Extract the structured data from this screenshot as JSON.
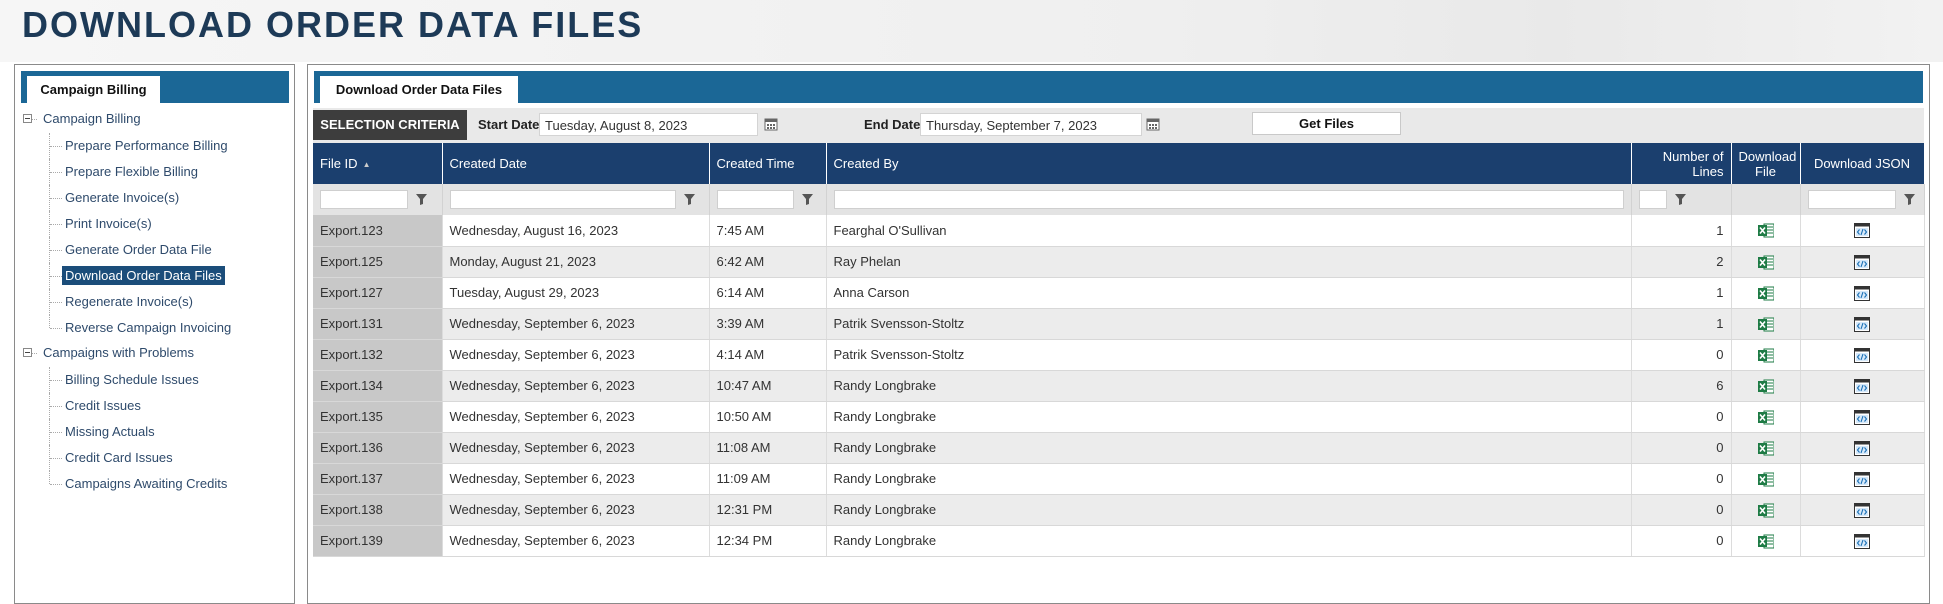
{
  "page": {
    "title": "DOWNLOAD ORDER DATA FILES"
  },
  "sidebar": {
    "tab_label": "Campaign Billing",
    "groups": [
      {
        "label": "Campaign Billing",
        "items": [
          {
            "label": "Prepare Performance Billing",
            "selected": false
          },
          {
            "label": "Prepare Flexible Billing",
            "selected": false
          },
          {
            "label": "Generate Invoice(s)",
            "selected": false
          },
          {
            "label": "Print Invoice(s)",
            "selected": false
          },
          {
            "label": "Generate Order Data File",
            "selected": false
          },
          {
            "label": "Download Order Data Files",
            "selected": true
          },
          {
            "label": "Regenerate Invoice(s)",
            "selected": false
          },
          {
            "label": "Reverse Campaign Invoicing",
            "selected": false
          }
        ]
      },
      {
        "label": "Campaigns with Problems",
        "items": [
          {
            "label": "Billing Schedule Issues",
            "selected": false
          },
          {
            "label": "Credit Issues",
            "selected": false
          },
          {
            "label": "Missing Actuals",
            "selected": false
          },
          {
            "label": "Credit Card Issues",
            "selected": false
          },
          {
            "label": "Campaigns Awaiting Credits",
            "selected": false
          }
        ]
      }
    ]
  },
  "main": {
    "tab_label": "Download Order Data Files",
    "criteria": {
      "label": "SELECTION CRITERIA",
      "start_label": "Start Date",
      "start_value": "Tuesday, August 8, 2023",
      "end_label": "End Date",
      "end_value": "Thursday, September 7, 2023",
      "button_label": "Get Files"
    },
    "columns": {
      "file_id": "File ID",
      "created_date": "Created Date",
      "created_time": "Created Time",
      "created_by": "Created By",
      "lines_1": "Number of",
      "lines_2": "Lines",
      "dl_file_1": "Download",
      "dl_file_2": "File",
      "dl_json": "Download JSON"
    },
    "rows": [
      {
        "id": "Export.123",
        "date": "Wednesday, August 16, 2023",
        "time": "7:45 AM",
        "by": "Fearghal O'Sullivan",
        "lines": "1"
      },
      {
        "id": "Export.125",
        "date": "Monday, August 21, 2023",
        "time": "6:42 AM",
        "by": "Ray Phelan",
        "lines": "2"
      },
      {
        "id": "Export.127",
        "date": "Tuesday, August 29, 2023",
        "time": "6:14 AM",
        "by": "Anna Carson",
        "lines": "1"
      },
      {
        "id": "Export.131",
        "date": "Wednesday, September 6, 2023",
        "time": "3:39 AM",
        "by": "Patrik Svensson-Stoltz",
        "lines": "1"
      },
      {
        "id": "Export.132",
        "date": "Wednesday, September 6, 2023",
        "time": "4:14 AM",
        "by": "Patrik Svensson-Stoltz",
        "lines": "0"
      },
      {
        "id": "Export.134",
        "date": "Wednesday, September 6, 2023",
        "time": "10:47 AM",
        "by": "Randy Longbrake",
        "lines": "6"
      },
      {
        "id": "Export.135",
        "date": "Wednesday, September 6, 2023",
        "time": "10:50 AM",
        "by": "Randy Longbrake",
        "lines": "0"
      },
      {
        "id": "Export.136",
        "date": "Wednesday, September 6, 2023",
        "time": "11:08 AM",
        "by": "Randy Longbrake",
        "lines": "0"
      },
      {
        "id": "Export.137",
        "date": "Wednesday, September 6, 2023",
        "time": "11:09 AM",
        "by": "Randy Longbrake",
        "lines": "0"
      },
      {
        "id": "Export.138",
        "date": "Wednesday, September 6, 2023",
        "time": "12:31 PM",
        "by": "Randy Longbrake",
        "lines": "0"
      },
      {
        "id": "Export.139",
        "date": "Wednesday, September 6, 2023",
        "time": "12:34 PM",
        "by": "Randy Longbrake",
        "lines": "0"
      }
    ],
    "icons": {
      "file": "excel-icon",
      "json": "json-code-icon",
      "filter": "filter-icon",
      "calendar": "calendar-icon"
    }
  },
  "colors": {
    "title": "#1d3a57",
    "tabbar": "#1b6796",
    "grid_header": "#1b3f6e",
    "selected_item": "#1b4d7a",
    "excel_green": "#1e7b45",
    "json_blue": "#1a6fb5"
  }
}
